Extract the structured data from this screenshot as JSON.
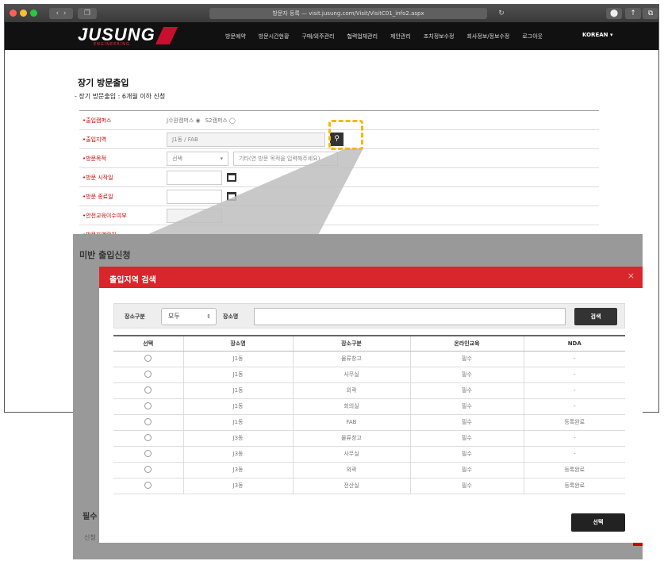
{
  "browser": {
    "url": "방문자 등록 — visit.jusung.com/Visit/VisitC01_info2.aspx",
    "back": "‹",
    "forward": "›",
    "sidebar_icon": "❐",
    "reload": "↻",
    "right_icons": [
      "⬤",
      "↑",
      "⧉"
    ],
    "light_colors": [
      "#ff5f57",
      "#febc2e",
      "#28c840"
    ]
  },
  "site": {
    "logo": "JUSUNG",
    "logo_sub": "ENGINEERING",
    "menu": [
      "방문예약",
      "방문시간현황",
      "구매/외주관리",
      "협력업체관리",
      "제안관리",
      "조치정보수정",
      "회사정보/정보수정",
      "로그아웃"
    ],
    "lang": "KOREAN ▾"
  },
  "page": {
    "title": "장기 방문출입",
    "subtitle": "- 장기 방문출입 : 6개월 이하 신청"
  },
  "form": {
    "campus_label": "•출입캠퍼스",
    "campus_opt1": "J수원캠퍼스 ◉",
    "campus_opt2": "S2캠퍼스 ◯",
    "area_label": "•출입지역",
    "area_value": "J1동 / FAB",
    "purpose_label": "•방문목적",
    "purpose_select": "선택",
    "purpose_placeholder": "기타(연 방문 목적을 입력해주세요)",
    "start_label": "•방문 시작일",
    "end_label": "•방문 종료일",
    "safety_label": "•안전교육이수여부",
    "last_label": "•방문자연락처"
  },
  "background": {
    "heading": "미반 출입신청",
    "left1": "필수",
    "left2": "신청"
  },
  "modal": {
    "title": "출입지역 검색",
    "close": "×",
    "search": {
      "type_label": "장소구분",
      "type_value": "모두",
      "name_label": "장소명",
      "name_value": "",
      "button": "검색"
    },
    "columns": [
      "선택",
      "장소명",
      "장소구분",
      "온라인교육",
      "NDA"
    ],
    "rows": [
      [
        "J1동",
        "물류창고",
        "필수",
        "-"
      ],
      [
        "J1동",
        "사무실",
        "필수",
        "-"
      ],
      [
        "J1동",
        "외곽",
        "필수",
        "-"
      ],
      [
        "J1동",
        "회의실",
        "필수",
        "-"
      ],
      [
        "J1동",
        "FAB",
        "필수",
        "등록완료"
      ],
      [
        "J3동",
        "물류창고",
        "필수",
        "-"
      ],
      [
        "J3동",
        "사무실",
        "필수",
        "-"
      ],
      [
        "J3동",
        "외곽",
        "필수",
        "등록완료"
      ],
      [
        "J3동",
        "전산실",
        "필수",
        "등록완료"
      ]
    ],
    "select_button": "선택"
  },
  "colors": {
    "accent": "#d9262c",
    "highlight": "#f5b800",
    "dark": "#222222"
  }
}
